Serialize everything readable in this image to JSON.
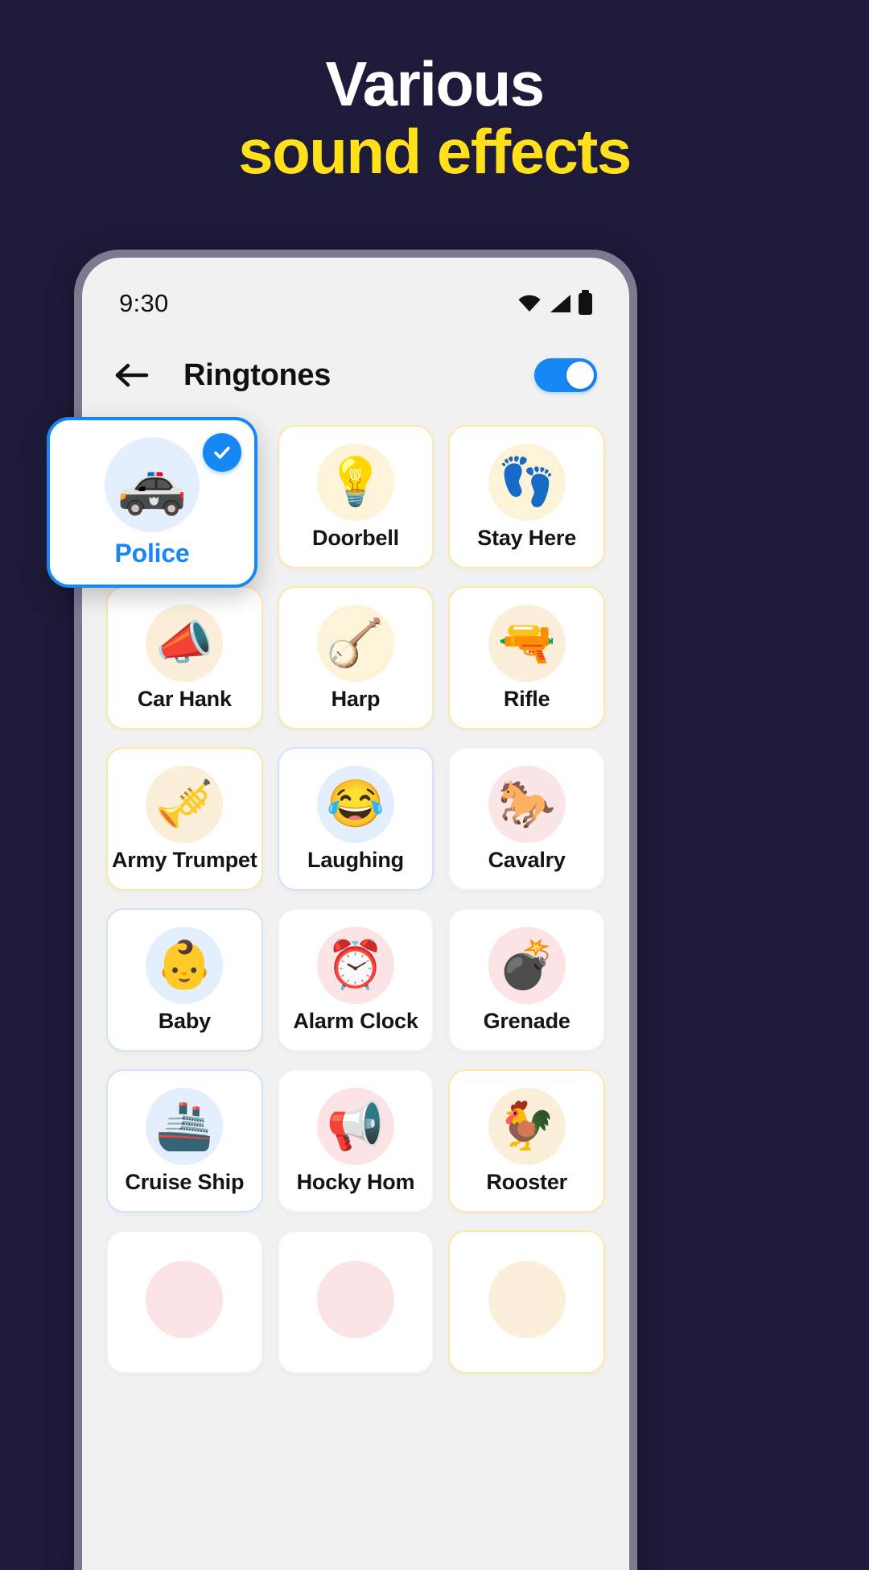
{
  "headline": {
    "line1": "Various",
    "line2": "sound effects",
    "white": "#FFFFFF",
    "yellow": "#FFE01B",
    "background": "#1E1B3A"
  },
  "phone": {
    "status": {
      "time": "9:30",
      "wifi_icon": "wifi-icon",
      "signal_icon": "cellular-signal-icon",
      "battery_icon": "battery-full-icon"
    },
    "nav": {
      "back_icon": "back-arrow-icon",
      "title": "Ringtones",
      "toggle_on": true,
      "toggle_color": "#1787F5"
    },
    "selected": {
      "label": "Police",
      "emoji": "🚓",
      "icon_name": "police-car-emoji",
      "check_icon": "check-icon",
      "accent": "#1787F5"
    },
    "grid": {
      "items": [
        {
          "label": "",
          "emoji": "",
          "icon_name": "placeholder-slot",
          "tone": "",
          "bubble": "",
          "hidden": true
        },
        {
          "label": "Doorbell",
          "emoji": "💡",
          "icon_name": "doorbell-emoji",
          "tone": "",
          "bubble": "bub-yellow"
        },
        {
          "label": "Stay Here",
          "emoji": "👣",
          "icon_name": "footprints-emoji",
          "tone": "",
          "bubble": "bub-yellow"
        },
        {
          "label": "Car Hank",
          "emoji": "📣",
          "icon_name": "megaphone-emoji",
          "tone": "",
          "bubble": "bub-amber"
        },
        {
          "label": "Harp",
          "emoji": "🪕",
          "icon_name": "harp-emoji",
          "tone": "",
          "bubble": "bub-yellow"
        },
        {
          "label": "Rifle",
          "emoji": "🔫",
          "icon_name": "rifle-emoji",
          "tone": "",
          "bubble": "bub-amber"
        },
        {
          "label": "Army Trumpet",
          "emoji": "🎺",
          "icon_name": "trumpet-emoji",
          "tone": "",
          "bubble": "bub-amber"
        },
        {
          "label": "Laughing",
          "emoji": "😂",
          "icon_name": "laughing-emoji",
          "tone": "tone-blue",
          "bubble": "bub-blue"
        },
        {
          "label": "Cavalry",
          "emoji": "🐎",
          "icon_name": "horse-emoji",
          "tone": "tone-plain",
          "bubble": "bub-rose"
        },
        {
          "label": "Baby",
          "emoji": "👶",
          "icon_name": "baby-emoji",
          "tone": "tone-blue",
          "bubble": "bub-blue"
        },
        {
          "label": "Alarm Clock",
          "emoji": "⏰",
          "icon_name": "alarm-clock-emoji",
          "tone": "tone-plain",
          "bubble": "bub-pink"
        },
        {
          "label": "Grenade",
          "emoji": "💣",
          "icon_name": "bomb-emoji",
          "tone": "tone-plain",
          "bubble": "bub-pink"
        },
        {
          "label": "Cruise Ship",
          "emoji": "🚢",
          "icon_name": "ship-emoji",
          "tone": "tone-blue",
          "bubble": "bub-blue"
        },
        {
          "label": "Hocky Hom",
          "emoji": "📢",
          "icon_name": "loudspeaker-emoji",
          "tone": "tone-plain",
          "bubble": "bub-pink"
        },
        {
          "label": "Rooster",
          "emoji": "🐓",
          "icon_name": "rooster-emoji",
          "tone": "",
          "bubble": "bub-amber"
        },
        {
          "label": "",
          "emoji": "",
          "icon_name": "row-partial-1",
          "tone": "tone-plain",
          "bubble": "bub-pink",
          "partial": true
        },
        {
          "label": "",
          "emoji": "",
          "icon_name": "row-partial-2",
          "tone": "tone-plain",
          "bubble": "bub-pink",
          "partial": true
        },
        {
          "label": "",
          "emoji": "",
          "icon_name": "row-partial-3",
          "tone": "",
          "bubble": "bub-amber",
          "partial": true
        }
      ]
    }
  }
}
